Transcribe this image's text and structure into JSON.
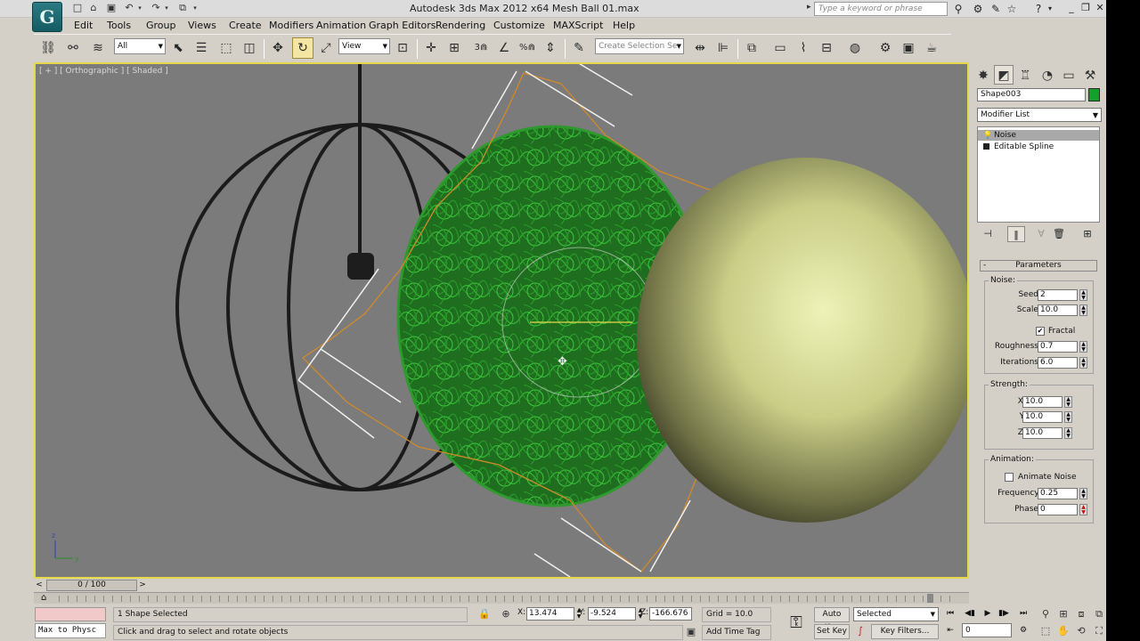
{
  "titlebar": {
    "title": "Autodesk 3ds Max  2012 x64      Mesh Ball 01.max",
    "logo_glyph": "G",
    "search_placeholder": "Type a keyword or phrase",
    "quick_access_icons": [
      "new-file-icon",
      "open-file-icon",
      "save-icon",
      "undo-icon",
      "redo-icon",
      "project-folder-icon"
    ]
  },
  "menubar": {
    "items": [
      "Edit",
      "Tools",
      "Group",
      "Views",
      "Create",
      "Modifiers",
      "Animation",
      "Graph Editors",
      "Rendering",
      "Customize",
      "MAXScript",
      "Help"
    ]
  },
  "toolbar": {
    "selection_filter": "All",
    "reference_coord": "View",
    "named_selection_placeholder": "Create Selection Se",
    "snap_labels": [
      "3",
      "%"
    ]
  },
  "viewport": {
    "label": "[ + ] [ Orthographic ] [ Shaded ]"
  },
  "command_panel": {
    "object_name": "Shape003",
    "object_color": "#12a22a",
    "modifier_list_label": "Modifier List",
    "stack": [
      "Noise",
      "Editable Spline"
    ],
    "rollout_title": "Parameters",
    "noise": {
      "title": "Noise:",
      "seed_label": "Seed:",
      "seed": "2",
      "scale_label": "Scale:",
      "scale": "10.0",
      "fractal_label": "Fractal",
      "fractal_checked": "✔",
      "roughness_label": "Roughness:",
      "roughness": "0.7",
      "iterations_label": "Iterations:",
      "iterations": "6.0"
    },
    "strength": {
      "title": "Strength:",
      "x_label": "X:",
      "x": "10.0",
      "y_label": "Y:",
      "y": "10.0",
      "z_label": "Z:",
      "z": "10.0"
    },
    "animation": {
      "title": "Animation:",
      "animate_noise_label": "Animate Noise",
      "frequency_label": "Frequency:",
      "frequency": "0.25",
      "phase_label": "Phase:",
      "phase": "0"
    }
  },
  "timeline": {
    "slider_label": "0 / 100"
  },
  "statusbar": {
    "maxscript_listener": "Max to Physc",
    "selection_status": "1 Shape Selected",
    "prompt": "Click and drag to select and rotate objects",
    "x_label": "X:",
    "x": "13.474",
    "y_label": "Y:",
    "y": "-9.524",
    "z_label": "Z:",
    "z": "-166.676",
    "grid": "Grid = 10.0",
    "add_time_tag": "Add Time Tag",
    "auto_key": "Auto Key",
    "set_key": "Set Key",
    "key_mode": "Selected",
    "key_filters": "Key Filters...",
    "current_frame": "0"
  }
}
